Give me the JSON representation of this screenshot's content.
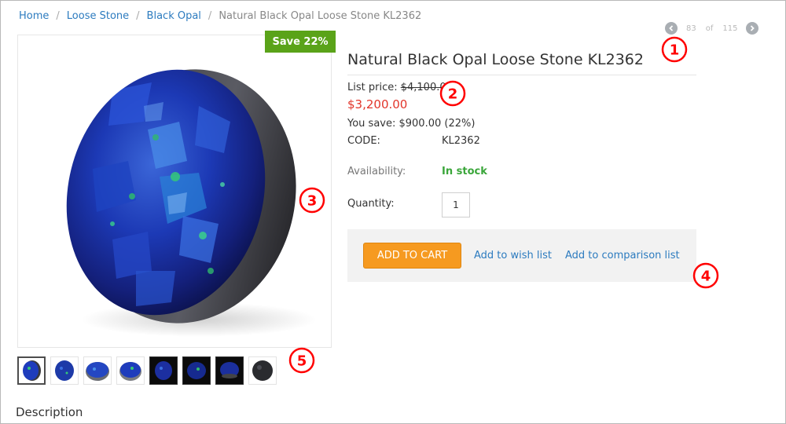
{
  "breadcrumb": {
    "items": [
      "Home",
      "Loose Stone",
      "Black Opal"
    ],
    "current": "Natural Black Opal Loose Stone KL2362"
  },
  "pager": {
    "current": "83",
    "of": "of",
    "total": "115"
  },
  "markers": [
    "①",
    "②",
    "③",
    "④",
    "⑤"
  ],
  "badge": {
    "save": "Save 22%"
  },
  "product": {
    "title": "Natural Black Opal Loose Stone KL2362",
    "list_price_label": "List price:",
    "list_price_value": "$4,100.00",
    "price": "$3,200.00",
    "you_save": "You save: $900.00 (22%)",
    "code_label": "CODE:",
    "code_value": "KL2362",
    "availability_label": "Availability:",
    "availability_value": "In stock",
    "quantity_label": "Quantity:",
    "quantity_value": "1"
  },
  "actions": {
    "add_to_cart": "ADD TO CART",
    "wish_list": "Add to wish list",
    "comparison": "Add to comparison list"
  },
  "description_title": "Description",
  "colors": {
    "link": "#2c7bbf",
    "price": "#e2352a",
    "in_stock": "#3aa63a",
    "badge": "#5aa319",
    "cart_button": "#f69a20",
    "marker": "#ff0000"
  }
}
